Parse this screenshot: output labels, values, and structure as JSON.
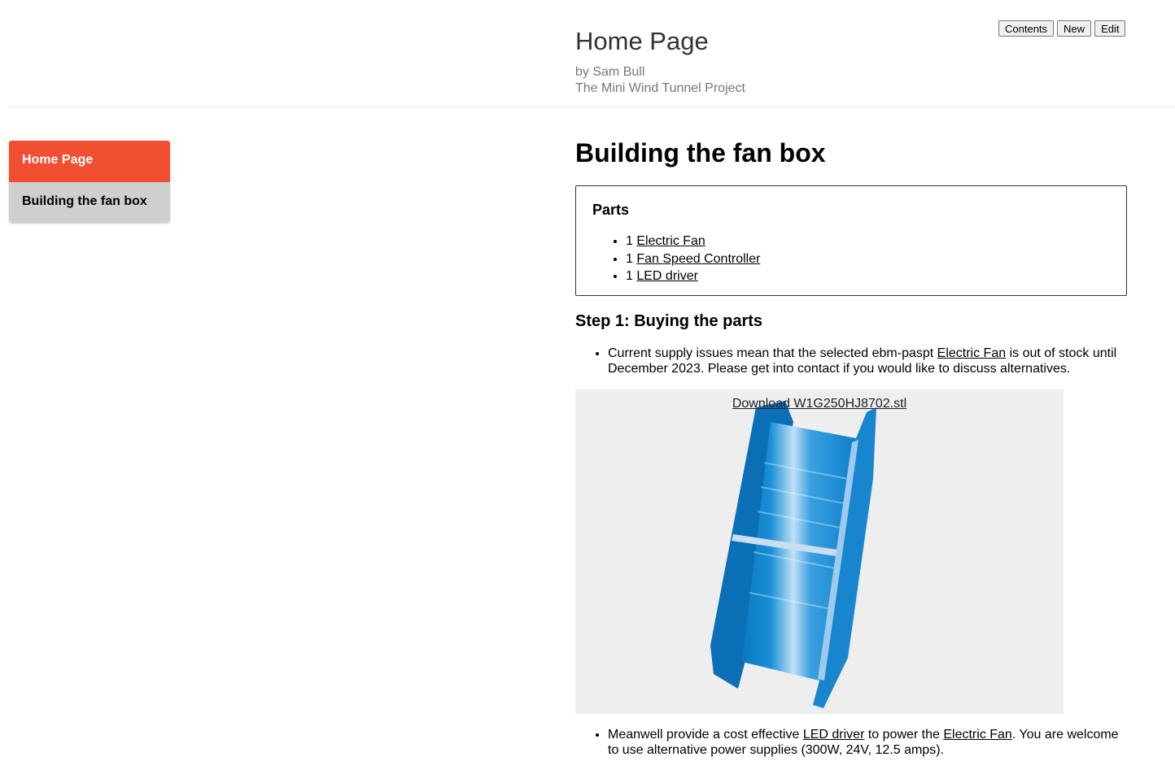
{
  "header": {
    "title": "Home Page",
    "author": "by Sam Bull",
    "project": "The Mini Wind Tunnel Project",
    "buttons": {
      "contents": "Contents",
      "new": "New",
      "edit": "Edit"
    }
  },
  "sidebar": {
    "items": [
      {
        "label": "Home Page",
        "active": true
      },
      {
        "label": "Building the fan box",
        "active": false
      }
    ]
  },
  "main": {
    "title": "Building the fan box",
    "parts": {
      "title": "Parts",
      "items": [
        {
          "qty": "1",
          "name": "Electric Fan"
        },
        {
          "qty": "1",
          "name": "Fan Speed Controller"
        },
        {
          "qty": "1",
          "name": "LED driver"
        }
      ]
    },
    "step1": {
      "title": "Step 1: Buying the parts",
      "bullet1": {
        "pre": "Current supply issues mean that the selected ebm-paspt ",
        "link": "Electric Fan",
        "post": " is out of stock until December 2023. Please get into contact if you would like to discuss alternatives."
      },
      "viewer": {
        "download": "Download W1G250HJ8702.stl",
        "background": "#eeeeee",
        "model_color": "#1a8fd6"
      },
      "bullet2": {
        "pre": "Meanwell provide a cost effective ",
        "link1": "LED driver",
        "mid": " to power the ",
        "link2": "Electric Fan",
        "post": ". You are welcome to use alternative power supplies (300W, 24V, 12.5 amps)."
      }
    }
  },
  "colors": {
    "accent": "#f24e31",
    "sidebar_inactive": "#cfcfcf",
    "header_text": "#333333",
    "muted_text": "#777777"
  }
}
